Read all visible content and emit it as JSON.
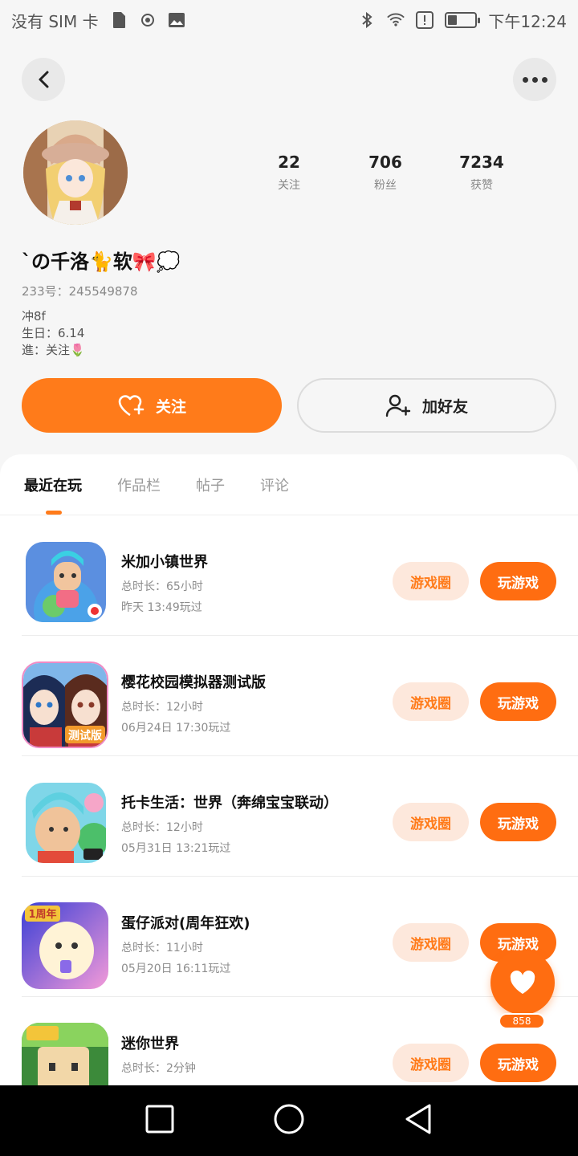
{
  "status_bar": {
    "carrier": "没有 SIM 卡",
    "time": "下午12:24",
    "battery_level": 0.35
  },
  "profile": {
    "nickname": "`の千洛🐈软🎀💭",
    "uid": "233号：245549878",
    "bio": "冲8f\n生日：6.14\n進：关注🌷",
    "stats": [
      {
        "value": "22",
        "label": "关注"
      },
      {
        "value": "706",
        "label": "粉丝"
      },
      {
        "value": "7234",
        "label": "获赞"
      }
    ],
    "follow_label": "关注",
    "add_friend_label": "加好友"
  },
  "tabs": [
    {
      "label": "最近在玩",
      "active": true
    },
    {
      "label": "作品栏",
      "active": false
    },
    {
      "label": "帖子",
      "active": false
    },
    {
      "label": "评论",
      "active": false
    }
  ],
  "games": [
    {
      "title": "米加小镇世界",
      "total": "总时长：65小时",
      "last": "昨天 13:49玩过",
      "circle": "游戏圈",
      "play": "玩游戏"
    },
    {
      "title": "樱花校园模拟器测试版",
      "total": "总时长：12小时",
      "last": "06月24日 17:30玩过",
      "circle": "游戏圈",
      "play": "玩游戏"
    },
    {
      "title": "托卡生活：世界（奔绵宝宝联动）",
      "total": "总时长：12小时",
      "last": "05月31日 13:21玩过",
      "circle": "游戏圈",
      "play": "玩游戏"
    },
    {
      "title": "蛋仔派对(周年狂欢)",
      "total": "总时长：11小时",
      "last": "05月20日 16:11玩过",
      "circle": "游戏圈",
      "play": "玩游戏"
    },
    {
      "title": "迷你世界",
      "total": "总时长：2分钟",
      "last": "",
      "circle": "游戏圈",
      "play": "玩游戏"
    }
  ],
  "icon_badges": {
    "game3_badge": "测试版",
    "game4_badge": "1周年"
  },
  "like_fab": {
    "count": "858"
  },
  "colors": {
    "accent": "#ff7b1a",
    "accent_light": "#fde8dc"
  }
}
